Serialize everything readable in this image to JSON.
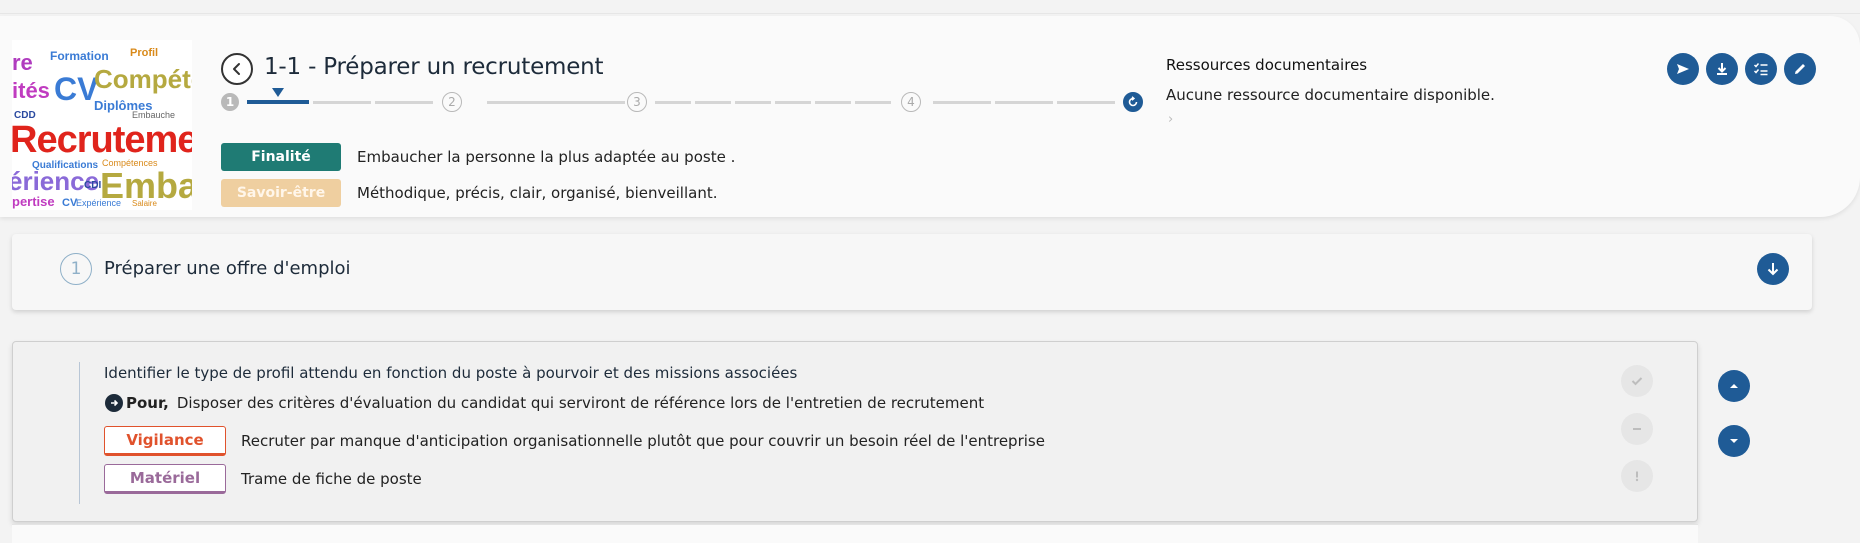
{
  "header": {
    "title": "1-1 - Préparer un recrutement",
    "stepper": {
      "steps": [
        "1",
        "2",
        "3",
        "4"
      ],
      "current": "1"
    },
    "finalite": {
      "label": "Finalité",
      "text": "Embaucher la personne la plus adaptée au poste ."
    },
    "savoir_etre": {
      "label": "Savoir-être",
      "text": "Méthodique, précis, clair, organisé, bienveillant."
    },
    "resources": {
      "title": "Ressources documentaires",
      "text": "Aucune ressource documentaire disponible."
    },
    "image_words": {
      "recrutement": "Recrutement",
      "competences": "Compétences",
      "embauche": "Embauche",
      "experience": "Expérience",
      "cv": "CV",
      "formation": "Formation",
      "diplomes": "Diplômes",
      "qualifications": "Qualifications",
      "profil": "Profil",
      "cdd": "CDD",
      "expertise": "Expertise",
      "salaire": "Salaire",
      "cdi": "CDI"
    },
    "colors": {
      "primary": "#1f5b96",
      "finalite": "#1f7b74",
      "savoir_etre": "#efcfa0"
    }
  },
  "offer": {
    "number": "1",
    "title": "Préparer une offre d'emploi"
  },
  "task": {
    "title": "Identifier le type de profil attendu en fonction du poste à pourvoir et des missions associées",
    "pour_label": "Pour,",
    "pour_text": "Disposer des critères d'évaluation du candidat qui serviront de référence lors de l'entretien de recrutement",
    "vigilance_label": "Vigilance",
    "vigilance_text": "Recruter par manque d'anticipation organisationnelle plutôt que pour couvrir un besoin réel de l'entreprise",
    "materiel_label": "Matériel",
    "materiel_text": "Trame de fiche de poste",
    "colors": {
      "vigilance": "#e0522c",
      "materiel": "#9a6a9a"
    }
  }
}
